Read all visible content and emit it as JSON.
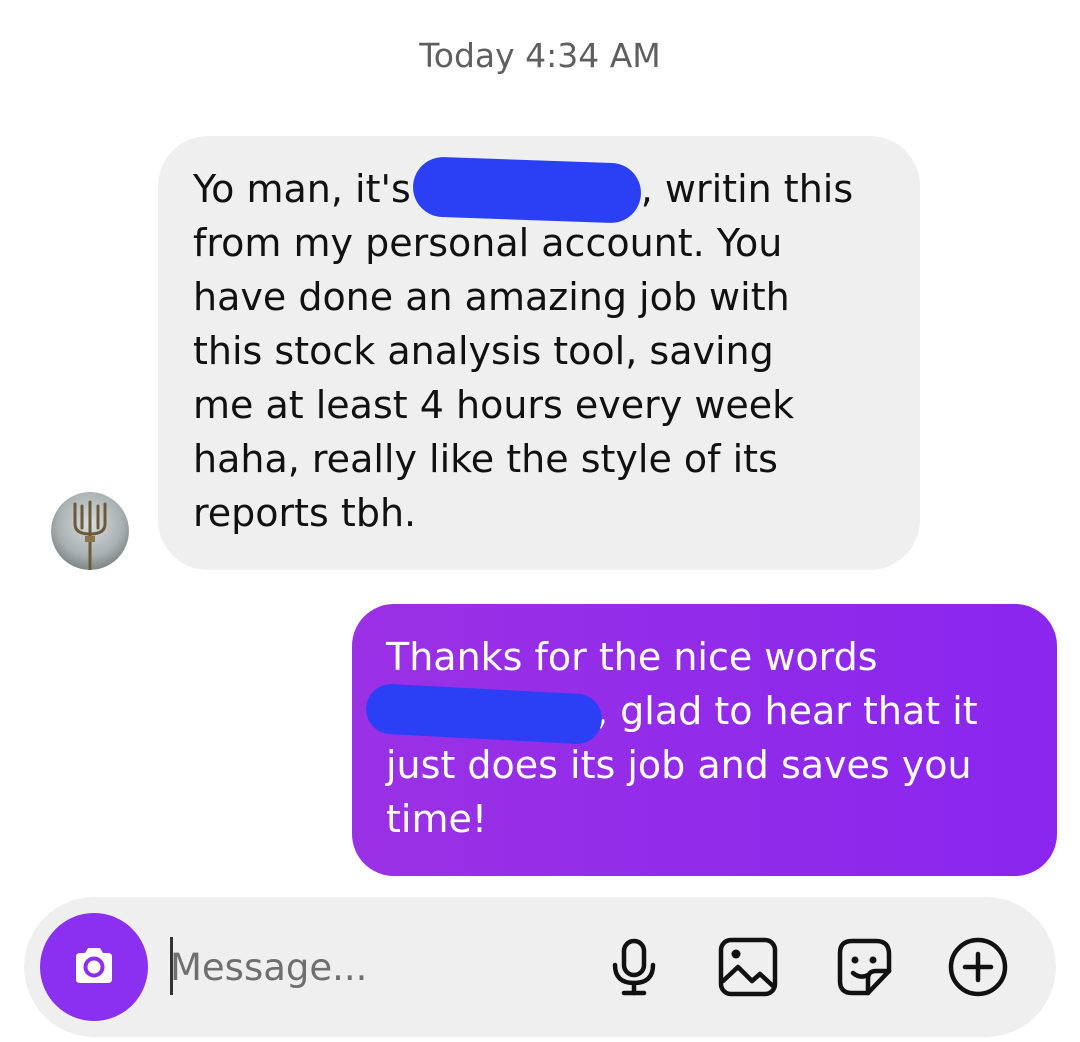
{
  "timestamp": "Today 4:34 AM",
  "incoming_message": {
    "lines": [
      {
        "before": "Yo man, it's",
        "after": ", writin this"
      },
      "from my personal account. You",
      "have done an amazing job with",
      "this stock analysis tool, saving",
      "me at least 4 hours every week",
      "haha, really like the style of its",
      "reports tbh."
    ],
    "sender_avatar": "trident-avatar"
  },
  "outgoing_message": {
    "lines": [
      "Thanks for the nice words",
      {
        "before": "",
        "after": ", glad to hear that it"
      },
      "just does its job and saves you",
      "time!"
    ]
  },
  "composer": {
    "placeholder": "Message...",
    "value": "",
    "icons": [
      "camera-icon",
      "microphone-icon",
      "gallery-icon",
      "sticker-icon",
      "add-icon"
    ]
  },
  "colors": {
    "outgoing_bubble": "#8b2ff0",
    "incoming_bubble": "#efefef",
    "redaction": "#2b3ff5",
    "camera_button": "#8b2ff0"
  }
}
